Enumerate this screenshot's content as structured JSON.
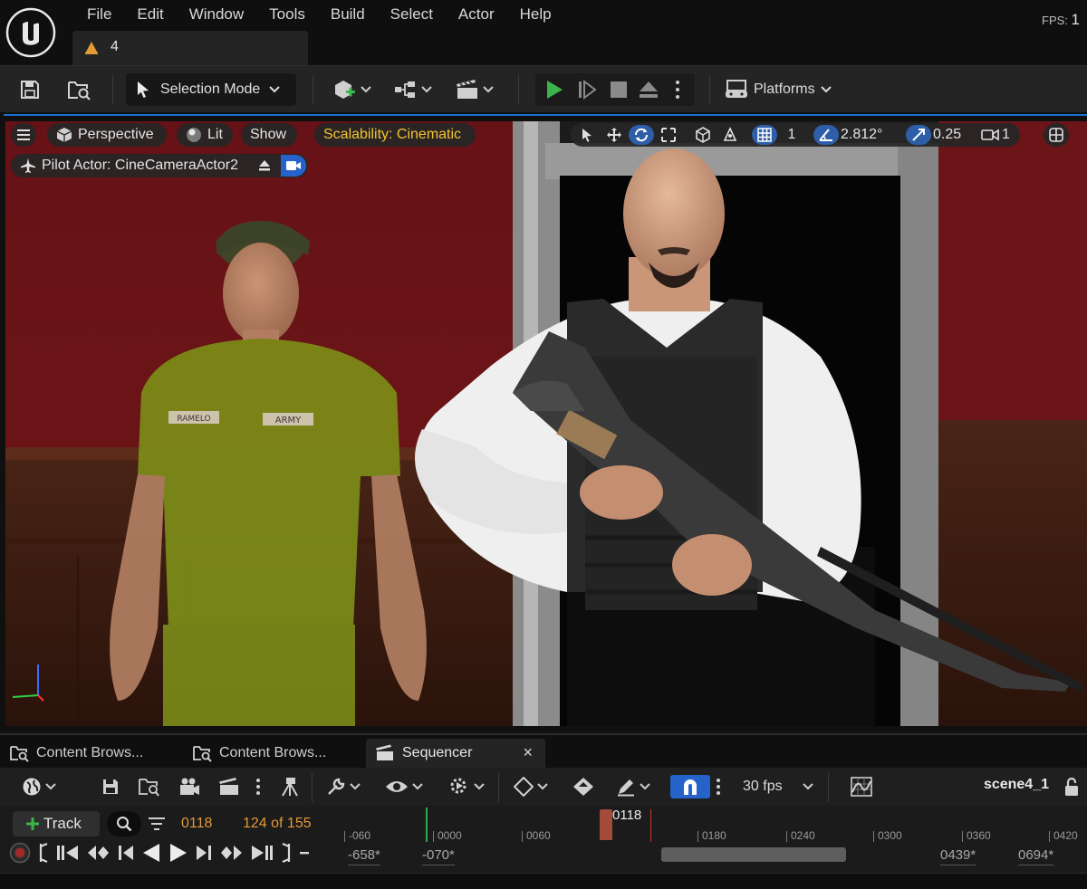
{
  "app": {
    "menu": [
      "File",
      "Edit",
      "Window",
      "Tools",
      "Build",
      "Select",
      "Actor",
      "Help"
    ],
    "level_tab": "4",
    "fps_label": "FPS:",
    "fps_value": "1"
  },
  "toolbar": {
    "selection_mode": "Selection Mode",
    "platforms": "Platforms"
  },
  "viewport": {
    "perspective": "Perspective",
    "lit": "Lit",
    "show": "Show",
    "scalability": "Scalability: Cinematic",
    "pilot_actor": "Pilot Actor: CineCameraActor2",
    "grid_size": "1",
    "rotation_snap": "2.812°",
    "scale_snap": "0.25",
    "camera_speed": "1",
    "name_tags": [
      "RAMELO",
      "ARMY"
    ]
  },
  "panel_tabs": [
    {
      "label": "Content Brows..."
    },
    {
      "label": "Content Brows..."
    },
    {
      "label": "Sequencer",
      "close": "×"
    }
  ],
  "sequencer": {
    "fps": "30 fps",
    "sequence_name": "scene4_1",
    "track_button": "Track",
    "current_frame": "0118",
    "frame_count": "124 of 155",
    "playhead_label": "0118",
    "ruler_ticks": [
      "-060",
      "0000",
      "0060",
      "0180",
      "0240",
      "0300",
      "0360",
      "0420"
    ],
    "range_values": [
      "-658*",
      "-070*",
      "0439*",
      "0694*"
    ]
  },
  "colors": {
    "accent_blue": "#2562c9",
    "play_green": "#3bb54a",
    "frame_orange": "#e39a37",
    "scalability_yellow": "#f2c531",
    "playhead_red": "#a44a3a"
  }
}
